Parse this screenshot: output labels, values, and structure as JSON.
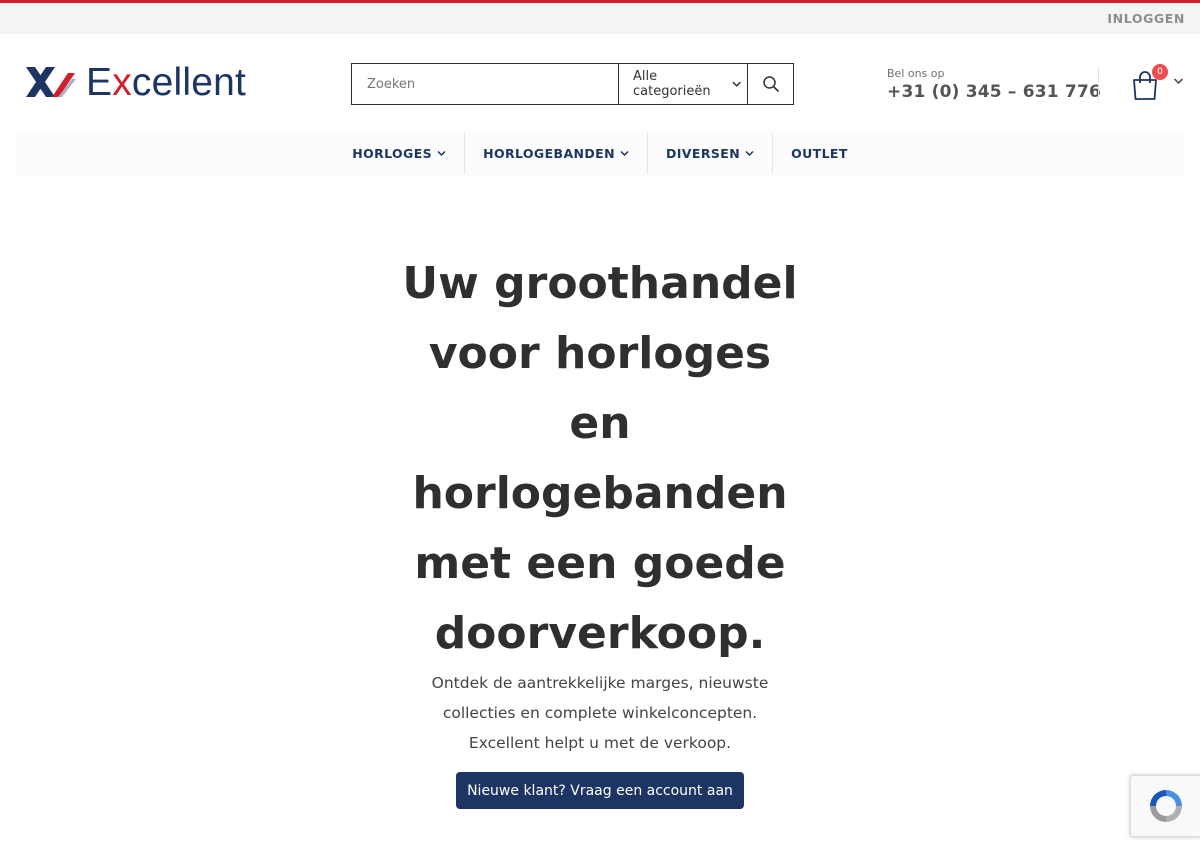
{
  "topbar": {
    "login_label": "INLOGGEN"
  },
  "logo": {
    "text_before": "E",
    "text_accent": "x",
    "text_after": "cellent"
  },
  "search": {
    "placeholder": "Zoeken",
    "category_selected": "Alle categorieën"
  },
  "contact": {
    "label": "Bel ons op",
    "phone": "+31 (0) 345 – 631 776"
  },
  "cart": {
    "count": "0"
  },
  "nav": {
    "items": [
      {
        "label": "HORLOGES"
      },
      {
        "label": "HORLOGEBANDEN"
      },
      {
        "label": "DIVERSEN"
      },
      {
        "label": "OUTLET"
      }
    ]
  },
  "hero": {
    "title": "Uw groothandel voor horloges en horlogebanden met een goede doorverkoop.",
    "subtitle": "Ontdek de aantrekkelijke marges, nieuwste collecties en complete winkelconcepten. Excellent helpt u met de verkoop.",
    "cta_label": "Nieuwe klant? Vraag een account aan"
  },
  "colors": {
    "accent_red": "#d21f2b",
    "brand_navy": "#1c3563",
    "badge_red": "#ea4d52"
  }
}
